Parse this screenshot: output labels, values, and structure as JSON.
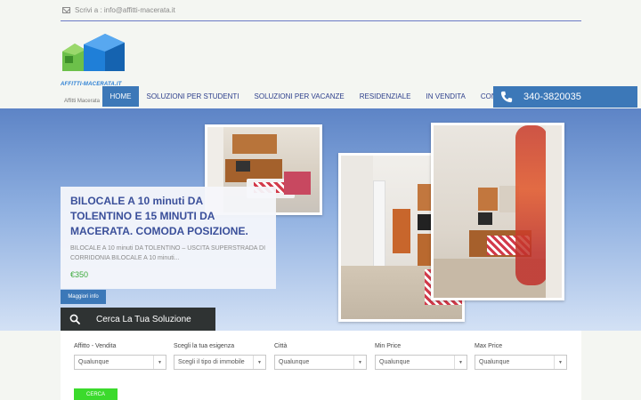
{
  "topbar": {
    "email_text": "Scrivi a : info@affitti-macerata.it"
  },
  "logo": {
    "name": "AFFITTI-MACERATA.IT",
    "tagline": "Affitti Macerata"
  },
  "nav": {
    "items": [
      {
        "label": "Home"
      },
      {
        "label": "Soluzioni per Studenti"
      },
      {
        "label": "Soluzioni per Vacanze"
      },
      {
        "label": "Residenziale"
      },
      {
        "label": "In Vendita"
      },
      {
        "label": "Contatti"
      }
    ],
    "active_index": 0,
    "phone": "340-3820035"
  },
  "listing": {
    "title": "BILOCALE A 10 minuti DA TOLENTINO E 15 MINUTI DA MACERATA. COMODA POSIZIONE.",
    "description": "BILOCALE A 10 minuti DA TOLENTINO – USCITA SUPERSTRADA DI CORRIDONIA BILOCALE A 10 minuti...",
    "price": "€350",
    "more_label": "Maggiori info"
  },
  "search": {
    "tab_label": "Cerca La Tua Soluzione",
    "fields": [
      {
        "label": "Affitto - Vendita",
        "value": "Qualunque"
      },
      {
        "label": "Scegli la tua esigenza",
        "value": "Scegli il tipo di immobile"
      },
      {
        "label": "Città",
        "value": "Qualunque"
      },
      {
        "label": "Min Price",
        "value": "Qualunque"
      },
      {
        "label": "Max Price",
        "value": "Qualunque"
      }
    ],
    "submit_label": "CERCA"
  },
  "colors": {
    "nav_text": "#2d3f8c",
    "accent_blue": "#3c78b8",
    "price_green": "#3aaa3a",
    "cerca_green": "#3bda2c",
    "search_tab_bg": "#2f3333"
  },
  "icons": [
    "envelope-icon",
    "house-logo-icon",
    "phone-icon",
    "search-icon",
    "chevron-down-icon"
  ]
}
